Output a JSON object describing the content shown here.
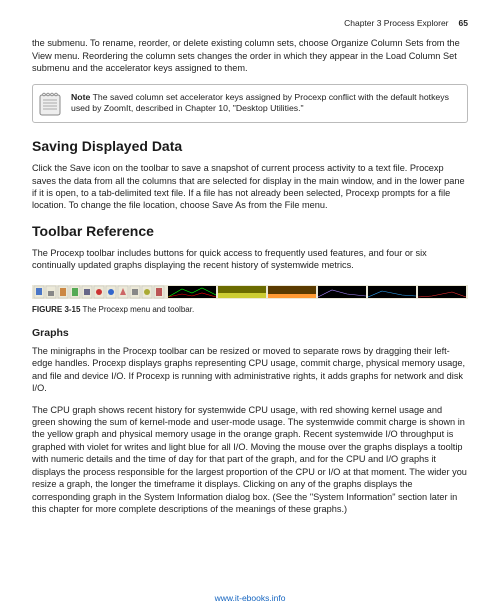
{
  "header": {
    "chapter": "Chapter 3    Process Explorer",
    "page": "65"
  },
  "intro_para": "the submenu. To rename, reorder, or delete existing column sets, choose Organize Column Sets from the View menu. Reordering the column sets changes the order in which they appear in the Load Column Set submenu and the accelerator keys assigned to them.",
  "note": {
    "label": "Note",
    "text": "The saved column set accelerator keys assigned by Procexp conflict with the default hotkeys used by ZoomIt, described in Chapter 10, \"Desktop Utilities.\""
  },
  "section_saving": {
    "title": "Saving Displayed Data",
    "body": "Click the Save icon on the toolbar to save a snapshot of current process activity to a text file. Procexp saves the data from all the columns that are selected for display in the main window, and in the lower pane if it is open, to a tab-delimited text file. If a file has not already been selected, Procexp prompts for a file location. To change the file location, choose Save As from the File menu."
  },
  "section_toolbar": {
    "title": "Toolbar Reference",
    "body": "The Procexp toolbar includes buttons for quick access to frequently used features, and four or six continually updated graphs displaying the recent history of systemwide metrics."
  },
  "figure": {
    "label": "FIGURE 3-15",
    "caption": "The Procexp menu and toolbar."
  },
  "graphs": {
    "title": "Graphs",
    "p1": "The minigraphs in the Procexp toolbar can be resized or moved to separate rows by dragging their left-edge handles. Procexp displays graphs representing CPU usage, commit charge, physical memory usage, and file and device I/O. If Procexp is running with administrative rights, it adds graphs for network and disk I/O.",
    "p2": "The CPU graph shows recent history for systemwide CPU usage, with red showing kernel usage and green showing the sum of kernel-mode and user-mode usage. The systemwide commit charge is shown in the yellow graph and physical memory usage in the orange graph. Recent systemwide I/O throughput is graphed with violet for writes and light blue for all I/O. Moving the mouse over the graphs displays a tooltip with numeric details and the time of day for that part of the graph, and for the CPU and I/O graphs it displays the process responsible for the largest proportion of the CPU or I/O at that moment. The wider you resize a graph, the longer the timeframe it displays. Clicking on any of the graphs displays the corresponding graph in the System Information dialog box. (See the \"System Information\" section later in this chapter for more complete descriptions of the meanings of these graphs.)"
  },
  "footer": {
    "url_text": "www.it-ebooks.info"
  }
}
